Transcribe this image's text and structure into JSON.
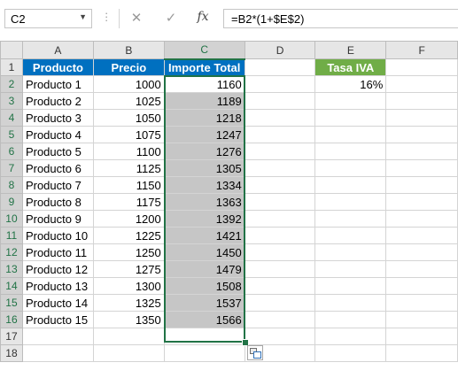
{
  "name_box": {
    "value": "C2"
  },
  "formula_bar": {
    "cancel_icon": "✕",
    "enter_icon": "✓",
    "function_label": "fx",
    "formula": "=B2*(1+$E$2)"
  },
  "columns": [
    "A",
    "B",
    "C",
    "D",
    "E",
    "F"
  ],
  "row_numbers": [
    "1",
    "2",
    "3",
    "4",
    "5",
    "6",
    "7",
    "8",
    "9",
    "10",
    "11",
    "12",
    "13",
    "14",
    "15",
    "16",
    "17",
    "18"
  ],
  "table": {
    "headers": {
      "a": "Producto",
      "b": "Precio",
      "c": "Importe Total"
    },
    "rows": [
      {
        "producto": "Producto 1",
        "precio": "1000",
        "importe": "1160"
      },
      {
        "producto": "Producto 2",
        "precio": "1025",
        "importe": "1189"
      },
      {
        "producto": "Producto 3",
        "precio": "1050",
        "importe": "1218"
      },
      {
        "producto": "Producto 4",
        "precio": "1075",
        "importe": "1247"
      },
      {
        "producto": "Producto 5",
        "precio": "1100",
        "importe": "1276"
      },
      {
        "producto": "Producto 6",
        "precio": "1125",
        "importe": "1305"
      },
      {
        "producto": "Producto 7",
        "precio": "1150",
        "importe": "1334"
      },
      {
        "producto": "Producto 8",
        "precio": "1175",
        "importe": "1363"
      },
      {
        "producto": "Producto 9",
        "precio": "1200",
        "importe": "1392"
      },
      {
        "producto": "Producto 10",
        "precio": "1225",
        "importe": "1421"
      },
      {
        "producto": "Producto 11",
        "precio": "1250",
        "importe": "1450"
      },
      {
        "producto": "Producto 12",
        "precio": "1275",
        "importe": "1479"
      },
      {
        "producto": "Producto 13",
        "precio": "1300",
        "importe": "1508"
      },
      {
        "producto": "Producto 14",
        "precio": "1325",
        "importe": "1537"
      },
      {
        "producto": "Producto 15",
        "precio": "1350",
        "importe": "1566"
      }
    ]
  },
  "tax": {
    "header": "Tasa IVA",
    "value": "16%"
  },
  "colors": {
    "blue_header": "#0070c0",
    "green_header": "#70ad47",
    "selection": "#217346"
  }
}
